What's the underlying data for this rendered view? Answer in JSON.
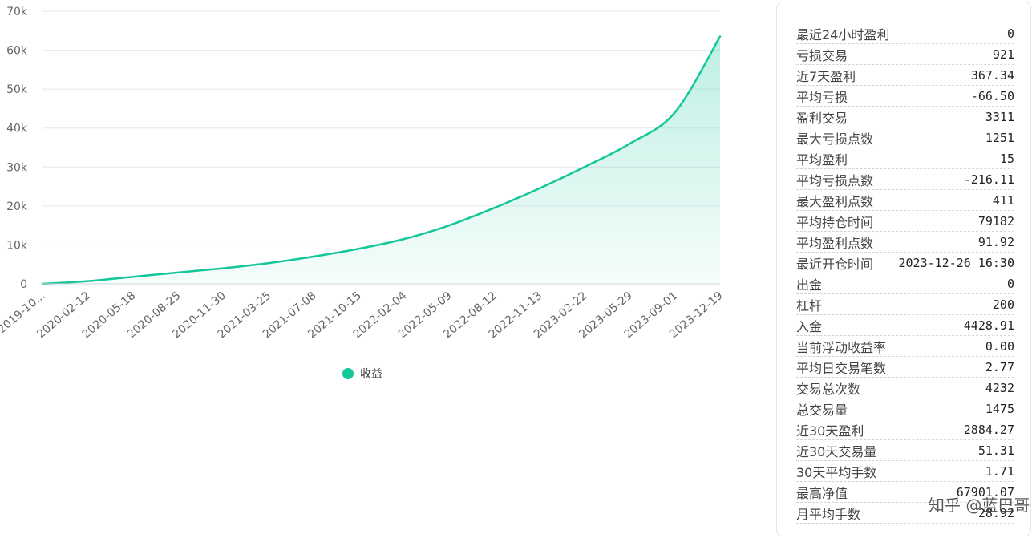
{
  "chart_data": {
    "type": "area",
    "title": "",
    "xlabel": "",
    "ylabel": "",
    "ylim": [
      0,
      70000
    ],
    "y_ticks": [
      0,
      10000,
      20000,
      30000,
      40000,
      50000,
      60000,
      70000
    ],
    "y_tick_labels": [
      "0",
      "10k",
      "20k",
      "30k",
      "40k",
      "50k",
      "60k",
      "70k"
    ],
    "x_tick_labels": [
      "2019-10...",
      "2020-02-12",
      "2020-05-18",
      "2020-08-25",
      "2020-11-30",
      "2021-03-25",
      "2021-07-08",
      "2021-10-15",
      "2022-02-04",
      "2022-05-09",
      "2022-08-12",
      "2022-11-13",
      "2023-02-22",
      "2023-05-29",
      "2023-09-01",
      "2023-12-19"
    ],
    "grid": true,
    "legend_position": "bottom",
    "series": [
      {
        "name": "收益",
        "color": "#14c79a",
        "x": [
          "2019-10",
          "2020-02-12",
          "2020-05-18",
          "2020-08-25",
          "2020-11-30",
          "2021-03-25",
          "2021-07-08",
          "2021-10-15",
          "2022-02-04",
          "2022-05-09",
          "2022-08-12",
          "2022-11-13",
          "2023-02-22",
          "2023-05-29",
          "2023-09-01",
          "2023-12-19"
        ],
        "values": [
          0,
          700,
          1800,
          2900,
          4000,
          5300,
          7000,
          9000,
          11500,
          15000,
          19500,
          24500,
          30000,
          36000,
          44000,
          63500
        ]
      }
    ]
  },
  "stats": [
    {
      "label": "最近24小时盈利",
      "value": "0"
    },
    {
      "label": "亏损交易",
      "value": "921"
    },
    {
      "label": "近7天盈利",
      "value": "367.34"
    },
    {
      "label": "平均亏损",
      "value": "-66.50"
    },
    {
      "label": "盈利交易",
      "value": "3311"
    },
    {
      "label": "最大亏损点数",
      "value": "1251"
    },
    {
      "label": "平均盈利",
      "value": "15"
    },
    {
      "label": "平均亏损点数",
      "value": "-216.11"
    },
    {
      "label": "最大盈利点数",
      "value": "411"
    },
    {
      "label": "平均持仓时间",
      "value": "79182"
    },
    {
      "label": "平均盈利点数",
      "value": "91.92"
    },
    {
      "label": "最近开仓时间",
      "value": "2023-12-26 16:30"
    },
    {
      "label": "出金",
      "value": "0"
    },
    {
      "label": "杠杆",
      "value": "200"
    },
    {
      "label": "入金",
      "value": "4428.91"
    },
    {
      "label": "当前浮动收益率",
      "value": "0.00"
    },
    {
      "label": "平均日交易笔数",
      "value": "2.77"
    },
    {
      "label": "交易总次数",
      "value": "4232"
    },
    {
      "label": "总交易量",
      "value": "1475"
    },
    {
      "label": "近30天盈利",
      "value": "2884.27"
    },
    {
      "label": "近30天交易量",
      "value": "51.31"
    },
    {
      "label": "30天平均手数",
      "value": "1.71"
    },
    {
      "label": "最高净值",
      "value": "67901.07"
    },
    {
      "label": "月平均手数",
      "value": "28.92"
    }
  ],
  "watermark": "知乎 @蓝巴哥"
}
